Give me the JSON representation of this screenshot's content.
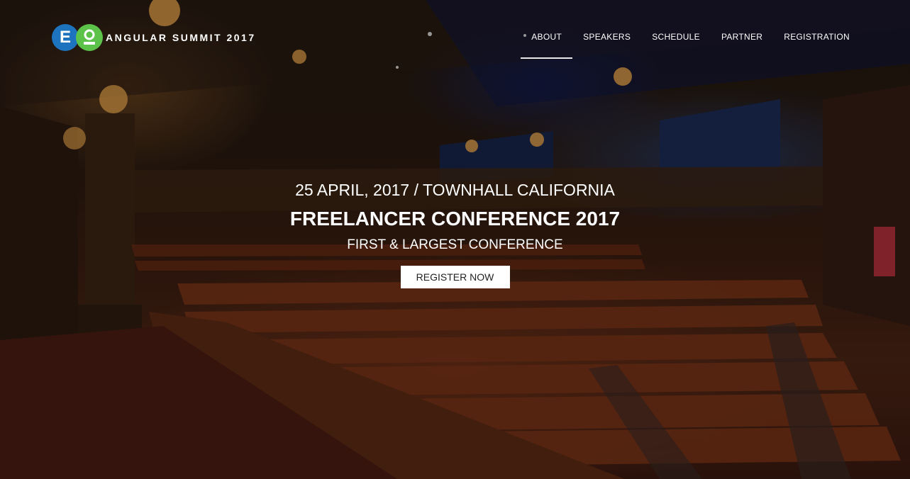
{
  "brand": {
    "logo_letter": "E",
    "title": "ANGULAR SUMMIT 2017",
    "colors": {
      "logo_left": "#1e73be",
      "logo_right": "#5cc24a"
    }
  },
  "nav": {
    "items": [
      {
        "label": "ABOUT",
        "active": true
      },
      {
        "label": "SPEAKERS",
        "active": false
      },
      {
        "label": "SCHEDULE",
        "active": false
      },
      {
        "label": "PARTNER",
        "active": false
      },
      {
        "label": "REGISTRATION",
        "active": false
      }
    ]
  },
  "hero": {
    "date_location": "25 APRIL, 2017 / TOWNHALL CALIFORNIA",
    "title": "FREELANCER CONFERENCE 2017",
    "subtitle": "FIRST & LARGEST CONFERENCE",
    "cta_label": "REGISTER NOW",
    "background_icon": "theater-auditorium-photo"
  }
}
